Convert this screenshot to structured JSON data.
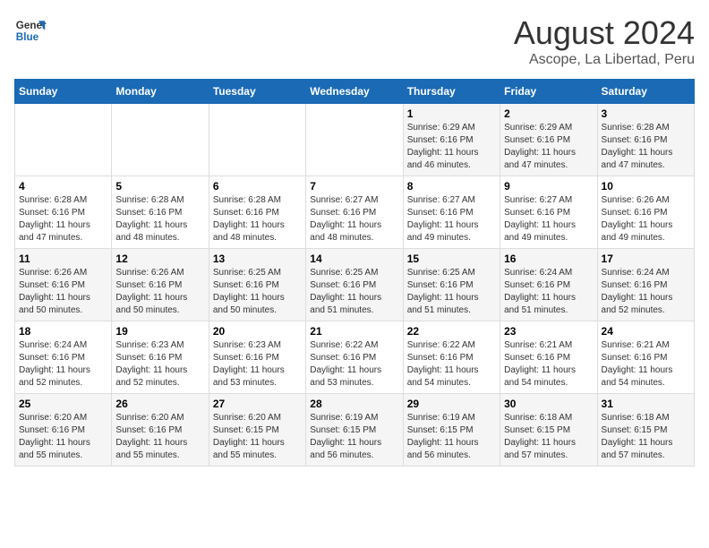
{
  "header": {
    "logo_line1": "General",
    "logo_line2": "Blue",
    "main_title": "August 2024",
    "subtitle": "Ascope, La Libertad, Peru"
  },
  "weekdays": [
    "Sunday",
    "Monday",
    "Tuesday",
    "Wednesday",
    "Thursday",
    "Friday",
    "Saturday"
  ],
  "weeks": [
    [
      {
        "day": "",
        "detail": ""
      },
      {
        "day": "",
        "detail": ""
      },
      {
        "day": "",
        "detail": ""
      },
      {
        "day": "",
        "detail": ""
      },
      {
        "day": "1",
        "detail": "Sunrise: 6:29 AM\nSunset: 6:16 PM\nDaylight: 11 hours\nand 46 minutes."
      },
      {
        "day": "2",
        "detail": "Sunrise: 6:29 AM\nSunset: 6:16 PM\nDaylight: 11 hours\nand 47 minutes."
      },
      {
        "day": "3",
        "detail": "Sunrise: 6:28 AM\nSunset: 6:16 PM\nDaylight: 11 hours\nand 47 minutes."
      }
    ],
    [
      {
        "day": "4",
        "detail": "Sunrise: 6:28 AM\nSunset: 6:16 PM\nDaylight: 11 hours\nand 47 minutes."
      },
      {
        "day": "5",
        "detail": "Sunrise: 6:28 AM\nSunset: 6:16 PM\nDaylight: 11 hours\nand 48 minutes."
      },
      {
        "day": "6",
        "detail": "Sunrise: 6:28 AM\nSunset: 6:16 PM\nDaylight: 11 hours\nand 48 minutes."
      },
      {
        "day": "7",
        "detail": "Sunrise: 6:27 AM\nSunset: 6:16 PM\nDaylight: 11 hours\nand 48 minutes."
      },
      {
        "day": "8",
        "detail": "Sunrise: 6:27 AM\nSunset: 6:16 PM\nDaylight: 11 hours\nand 49 minutes."
      },
      {
        "day": "9",
        "detail": "Sunrise: 6:27 AM\nSunset: 6:16 PM\nDaylight: 11 hours\nand 49 minutes."
      },
      {
        "day": "10",
        "detail": "Sunrise: 6:26 AM\nSunset: 6:16 PM\nDaylight: 11 hours\nand 49 minutes."
      }
    ],
    [
      {
        "day": "11",
        "detail": "Sunrise: 6:26 AM\nSunset: 6:16 PM\nDaylight: 11 hours\nand 50 minutes."
      },
      {
        "day": "12",
        "detail": "Sunrise: 6:26 AM\nSunset: 6:16 PM\nDaylight: 11 hours\nand 50 minutes."
      },
      {
        "day": "13",
        "detail": "Sunrise: 6:25 AM\nSunset: 6:16 PM\nDaylight: 11 hours\nand 50 minutes."
      },
      {
        "day": "14",
        "detail": "Sunrise: 6:25 AM\nSunset: 6:16 PM\nDaylight: 11 hours\nand 51 minutes."
      },
      {
        "day": "15",
        "detail": "Sunrise: 6:25 AM\nSunset: 6:16 PM\nDaylight: 11 hours\nand 51 minutes."
      },
      {
        "day": "16",
        "detail": "Sunrise: 6:24 AM\nSunset: 6:16 PM\nDaylight: 11 hours\nand 51 minutes."
      },
      {
        "day": "17",
        "detail": "Sunrise: 6:24 AM\nSunset: 6:16 PM\nDaylight: 11 hours\nand 52 minutes."
      }
    ],
    [
      {
        "day": "18",
        "detail": "Sunrise: 6:24 AM\nSunset: 6:16 PM\nDaylight: 11 hours\nand 52 minutes."
      },
      {
        "day": "19",
        "detail": "Sunrise: 6:23 AM\nSunset: 6:16 PM\nDaylight: 11 hours\nand 52 minutes."
      },
      {
        "day": "20",
        "detail": "Sunrise: 6:23 AM\nSunset: 6:16 PM\nDaylight: 11 hours\nand 53 minutes."
      },
      {
        "day": "21",
        "detail": "Sunrise: 6:22 AM\nSunset: 6:16 PM\nDaylight: 11 hours\nand 53 minutes."
      },
      {
        "day": "22",
        "detail": "Sunrise: 6:22 AM\nSunset: 6:16 PM\nDaylight: 11 hours\nand 54 minutes."
      },
      {
        "day": "23",
        "detail": "Sunrise: 6:21 AM\nSunset: 6:16 PM\nDaylight: 11 hours\nand 54 minutes."
      },
      {
        "day": "24",
        "detail": "Sunrise: 6:21 AM\nSunset: 6:16 PM\nDaylight: 11 hours\nand 54 minutes."
      }
    ],
    [
      {
        "day": "25",
        "detail": "Sunrise: 6:20 AM\nSunset: 6:16 PM\nDaylight: 11 hours\nand 55 minutes."
      },
      {
        "day": "26",
        "detail": "Sunrise: 6:20 AM\nSunset: 6:16 PM\nDaylight: 11 hours\nand 55 minutes."
      },
      {
        "day": "27",
        "detail": "Sunrise: 6:20 AM\nSunset: 6:15 PM\nDaylight: 11 hours\nand 55 minutes."
      },
      {
        "day": "28",
        "detail": "Sunrise: 6:19 AM\nSunset: 6:15 PM\nDaylight: 11 hours\nand 56 minutes."
      },
      {
        "day": "29",
        "detail": "Sunrise: 6:19 AM\nSunset: 6:15 PM\nDaylight: 11 hours\nand 56 minutes."
      },
      {
        "day": "30",
        "detail": "Sunrise: 6:18 AM\nSunset: 6:15 PM\nDaylight: 11 hours\nand 57 minutes."
      },
      {
        "day": "31",
        "detail": "Sunrise: 6:18 AM\nSunset: 6:15 PM\nDaylight: 11 hours\nand 57 minutes."
      }
    ]
  ]
}
